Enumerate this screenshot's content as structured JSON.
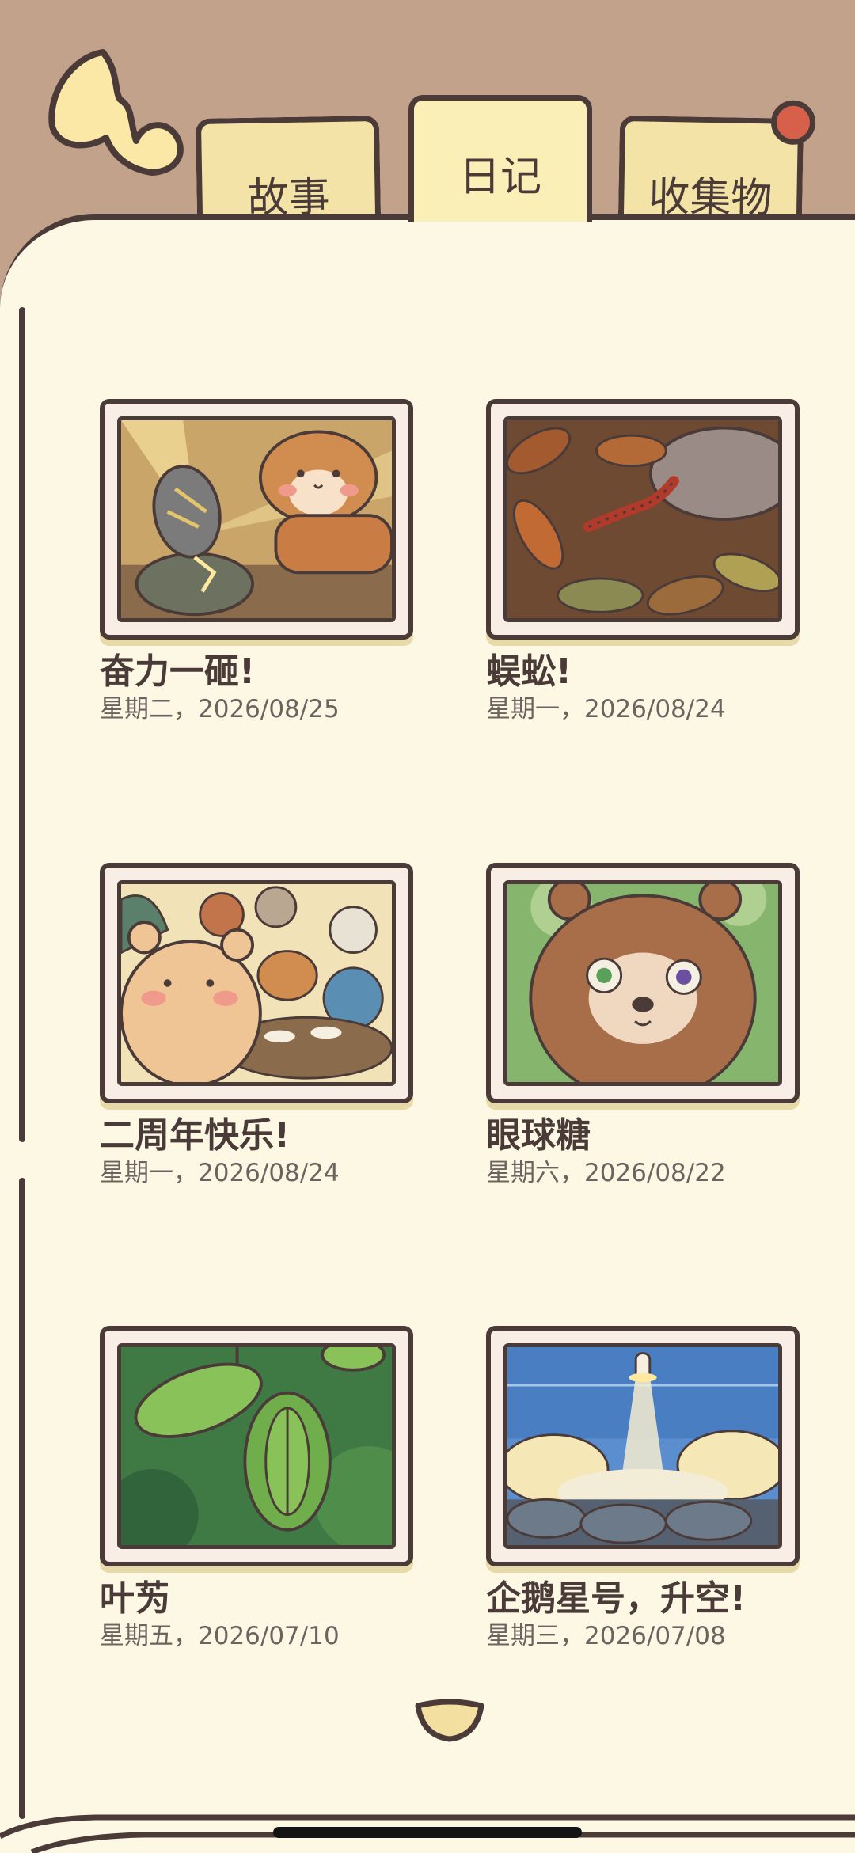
{
  "tabs": [
    {
      "label": "故事",
      "selected": false
    },
    {
      "label": "日记",
      "selected": true
    },
    {
      "label": "收集物",
      "selected": false,
      "has_notification": true
    }
  ],
  "entries": [
    {
      "title": "奋力一砸!",
      "date": "星期二，2026/08/25",
      "image": "squirrel-smashing-rock"
    },
    {
      "title": "蜈蚣!",
      "date": "星期一，2026/08/24",
      "image": "centipede-in-leaves"
    },
    {
      "title": "二周年快乐!",
      "date": "星期一，2026/08/24",
      "image": "anniversary-party"
    },
    {
      "title": "眼球糖",
      "date": "星期六，2026/08/22",
      "image": "bear-eyeball-candy"
    },
    {
      "title": "叶𫇭",
      "date": "星期五，2026/07/10",
      "image": "leaf-insect"
    },
    {
      "title": "企鹅星号，升空!",
      "date": "星期三，2026/07/08",
      "image": "rocket-launch"
    }
  ],
  "colors": {
    "background": "#c2a28a",
    "page": "#fdf8e4",
    "outline": "#4a3b39",
    "tab": "#f3e3a7",
    "badge": "#d6604a"
  }
}
